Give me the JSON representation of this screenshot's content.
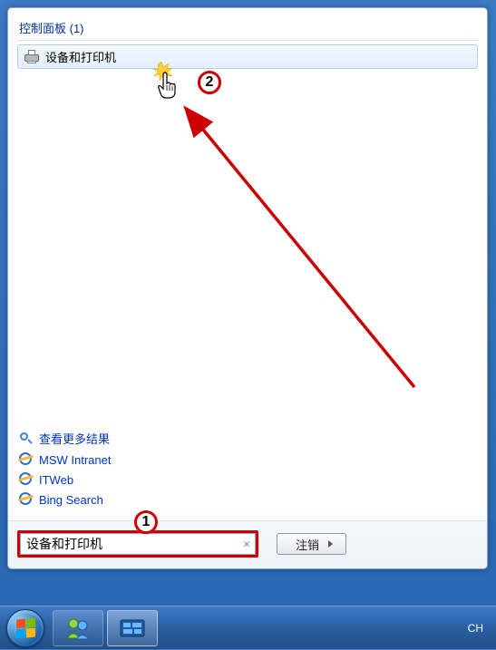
{
  "section": {
    "header": "控制面板 (1)"
  },
  "result": {
    "label": "设备和打印机"
  },
  "links": {
    "more_results": "查看更多结果",
    "msw": "MSW Intranet",
    "itweb": "ITWeb",
    "bing": "Bing Search"
  },
  "search": {
    "value": "设备和打印机",
    "clear": "×"
  },
  "logout": {
    "label": "注销"
  },
  "tray": {
    "ime": "CH"
  },
  "annotations": {
    "step1": "1",
    "step2": "2"
  }
}
